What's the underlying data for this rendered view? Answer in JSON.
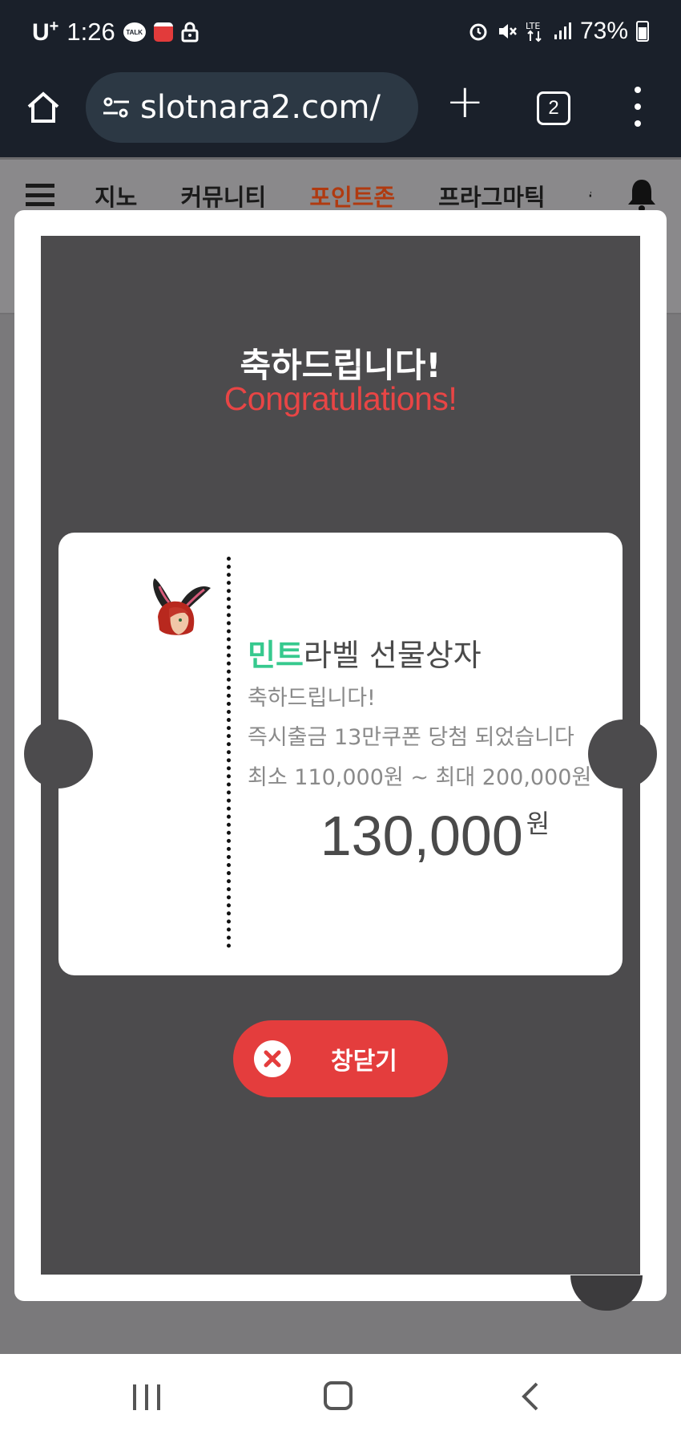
{
  "status_bar": {
    "carrier": "U",
    "carrier_sup": "+",
    "time": "1:26",
    "talk_badge": "TALK",
    "battery": "73%"
  },
  "browser": {
    "url": "slotnara2.com/",
    "tab_count": "2"
  },
  "site_nav": {
    "items": [
      {
        "label": "지노",
        "active": false
      },
      {
        "label": "커뮤니티",
        "active": false
      },
      {
        "label": "포인트존",
        "active": true
      },
      {
        "label": "프라그마틱",
        "active": false
      },
      {
        "label": "슬",
        "active": false
      }
    ]
  },
  "modal": {
    "title_ko": "축하드립니다!",
    "title_en": "Congratulations!",
    "ticket": {
      "brand": "민트",
      "title_rest": "라벨 선물상자",
      "message_1": "축하드립니다!",
      "message_2": "즉시출금 13만쿠폰 당첨 되었습니다",
      "message_3": "최소 110,000원 ~ 최대 200,000원",
      "amount": "130,000",
      "amount_unit": "원"
    },
    "close_label": "창닫기"
  },
  "colors": {
    "accent_red": "#e43d3d",
    "brand_green": "#36c98e",
    "nav_active": "#b03a10"
  }
}
